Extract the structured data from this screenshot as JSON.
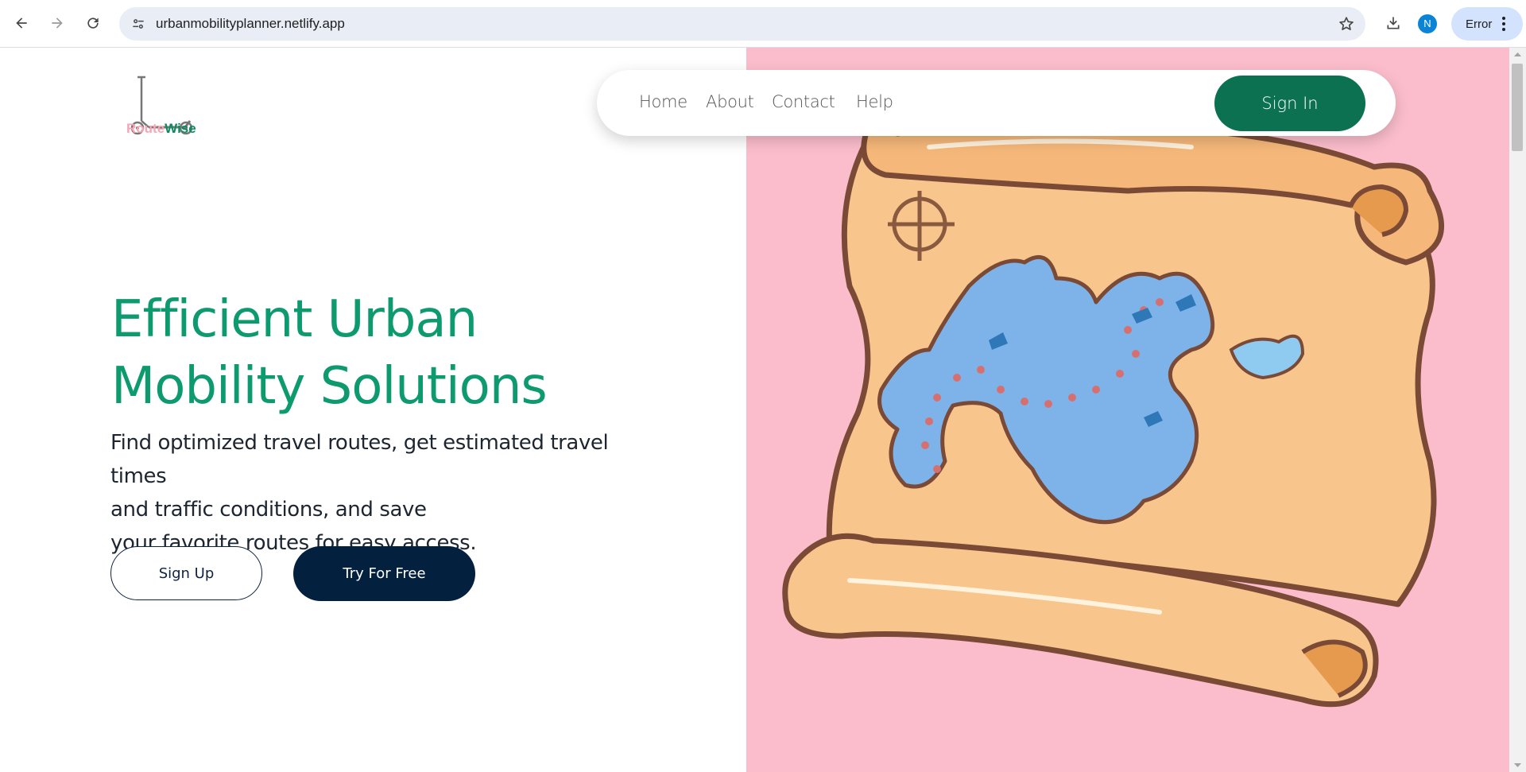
{
  "browser": {
    "url": "urbanmobilityplanner.netlify.app",
    "profile_initial": "N",
    "profile_status": "Error",
    "icons": {
      "back": "arrow-left-icon",
      "forward": "arrow-right-icon",
      "reload": "reload-icon",
      "site_info": "tune-icon",
      "bookmark": "star-icon",
      "download": "download-icon",
      "menu": "kebab-menu-icon"
    }
  },
  "logo": {
    "part1": "Route",
    "part2": "Wise"
  },
  "nav": {
    "links": [
      "Home",
      "About",
      "Contact",
      "Help"
    ],
    "signin_label": "Sign In"
  },
  "hero": {
    "title_line1": "Efficient Urban",
    "title_line2": "Mobility Solutions",
    "subtitle_line1": "Find optimized travel routes, get estimated travel times",
    "subtitle_line2": "and traffic conditions, and save",
    "subtitle_line3": "your favorite routes for easy access.",
    "signup_label": "Sign Up",
    "try_label": "Try For Free"
  },
  "colors": {
    "brand_green": "#0d9a6e",
    "signin_green": "#0b7150",
    "navy": "#03203f",
    "hero_pink": "#fbbdcb",
    "logo_pink": "#f7a6b8"
  }
}
